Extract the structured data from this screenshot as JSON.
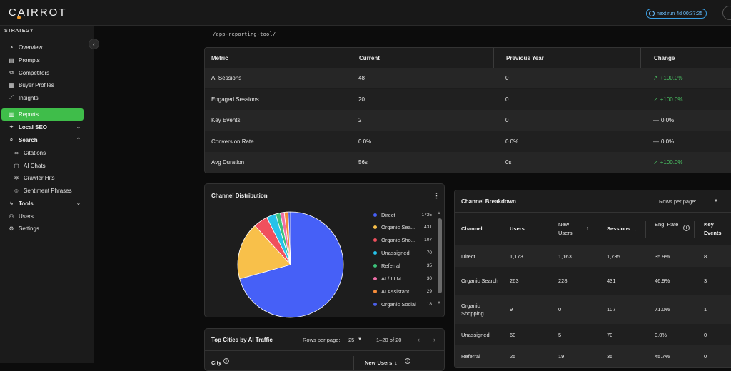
{
  "app": {
    "logo": "CAIRROT",
    "next_run": "next run 4d 00:37:25"
  },
  "sidebar": {
    "section": "STRATEGY",
    "items": [
      {
        "label": "Overview",
        "icon": "gauge-icon"
      },
      {
        "label": "Prompts",
        "icon": "prompts-icon"
      },
      {
        "label": "Competitors",
        "icon": "competitors-icon"
      },
      {
        "label": "Buyer Profiles",
        "icon": "buyer-profiles-icon"
      },
      {
        "label": "Insights",
        "icon": "insights-icon"
      },
      {
        "label": "Reports",
        "icon": "reports-icon",
        "active": true
      },
      {
        "label": "Local SEO",
        "icon": "pin-icon"
      },
      {
        "label": "Search",
        "icon": "search-icon"
      },
      {
        "label": "Citations",
        "icon": "link-icon"
      },
      {
        "label": "AI Chats",
        "icon": "chat-icon"
      },
      {
        "label": "Crawler Hits",
        "icon": "bug-icon"
      },
      {
        "label": "Sentiment Phrases",
        "icon": "smile-icon"
      },
      {
        "label": "Tools",
        "icon": "bolt-icon"
      },
      {
        "label": "Users",
        "icon": "users-icon"
      },
      {
        "label": "Settings",
        "icon": "gear-icon"
      }
    ]
  },
  "page": {
    "url_path": "/app-reporting-tool/"
  },
  "metrics": {
    "headers": [
      "Metric",
      "Current",
      "Previous Year",
      "Change"
    ],
    "rows": [
      {
        "metric": "AI Sessions",
        "current": "48",
        "previous": "0",
        "change": "+100.0%",
        "trend": "up"
      },
      {
        "metric": "Engaged Sessions",
        "current": "20",
        "previous": "0",
        "change": "+100.0%",
        "trend": "up"
      },
      {
        "metric": "Key Events",
        "current": "2",
        "previous": "0",
        "change": "0.0%",
        "trend": "flat"
      },
      {
        "metric": "Conversion Rate",
        "current": "0.0%",
        "previous": "0.0%",
        "change": "0.0%",
        "trend": "flat"
      },
      {
        "metric": "Avg Duration",
        "current": "56s",
        "previous": "0s",
        "change": "+100.0%",
        "trend": "up"
      }
    ]
  },
  "channel_distribution": {
    "title": "Channel Distribution",
    "legend": [
      {
        "label": "Direct",
        "value": "1735",
        "color": "#4660f7"
      },
      {
        "label": "Organic Sea...",
        "value": "431",
        "color": "#f8c04a"
      },
      {
        "label": "Organic Sho...",
        "value": "107",
        "color": "#f0505d"
      },
      {
        "label": "Unassigned",
        "value": "70",
        "color": "#26c2ea"
      },
      {
        "label": "Referral",
        "value": "35",
        "color": "#3cc27a"
      },
      {
        "label": "AI / LLM",
        "value": "30",
        "color": "#ef6fa8"
      },
      {
        "label": "AI Assistant",
        "value": "29",
        "color": "#f58c3a"
      },
      {
        "label": "Organic Social",
        "value": "18",
        "color": "#4b5fe8"
      }
    ]
  },
  "breakdown": {
    "title": "Channel Breakdown",
    "rows_per_page_label": "Rows per page:",
    "columns": [
      "Channel",
      "Users",
      "New Users",
      "Sessions",
      "Eng. Rate",
      "Key Events"
    ],
    "rows": [
      [
        "Direct",
        "1,173",
        "1,163",
        "1,735",
        "35.9%",
        "8"
      ],
      [
        "Organic Search",
        "263",
        "228",
        "431",
        "46.9%",
        "3"
      ],
      [
        "Organic Shopping",
        "9",
        "0",
        "107",
        "71.0%",
        "1"
      ],
      [
        "Unassigned",
        "60",
        "5",
        "70",
        "0.0%",
        "0"
      ],
      [
        "Referral",
        "25",
        "19",
        "35",
        "45.7%",
        "0"
      ]
    ]
  },
  "cities": {
    "title": "Top Cities by AI Traffic",
    "rows_per_page_label": "Rows per page:",
    "rows_per_page": "25",
    "range": "1–20 of 20",
    "columns": [
      "City",
      "New Users"
    ]
  },
  "chart_data": {
    "type": "pie",
    "categories": [
      "Direct",
      "Organic Search",
      "Organic Shopping",
      "Unassigned",
      "Referral",
      "AI / LLM",
      "AI Assistant",
      "Organic Social"
    ],
    "values": [
      1735,
      431,
      107,
      70,
      35,
      30,
      29,
      18
    ],
    "colors": [
      "#4660f7",
      "#f8c04a",
      "#f0505d",
      "#26c2ea",
      "#3cc27a",
      "#ef6fa8",
      "#f58c3a",
      "#4b5fe8"
    ],
    "title": "Channel Distribution",
    "legend": "right"
  }
}
